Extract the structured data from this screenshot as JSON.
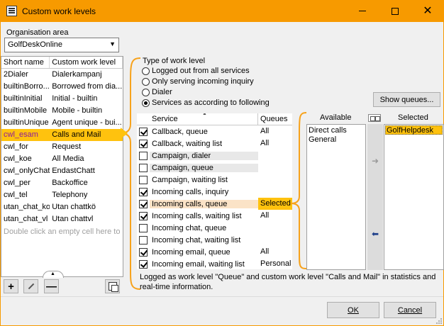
{
  "window": {
    "title": "Custom work levels",
    "controls": {
      "minimize": "—",
      "maximize": "☐",
      "close": "✕"
    }
  },
  "org": {
    "label": "Organisation area",
    "value": "GolfDeskOnline"
  },
  "levels": {
    "headers": [
      "Short name",
      "Custom work level"
    ],
    "rows": [
      [
        "2Dialer",
        "Dialerkampanj"
      ],
      [
        "builtinBorro...",
        "Borrowed from dia..."
      ],
      [
        "builtinInitial",
        "Initial - builtin"
      ],
      [
        "builtinMobile",
        "Mobile - builtin"
      ],
      [
        "builtinUnique",
        "Agent unique - bui..."
      ],
      [
        "cwl_esam",
        "Calls and Mail"
      ],
      [
        "cwl_for",
        "Request"
      ],
      [
        "cwl_koe",
        "All Media"
      ],
      [
        "cwl_onlyChat",
        "EndastChatt"
      ],
      [
        "cwl_per",
        "Backoffice"
      ],
      [
        "cwl_tel",
        "Telephony"
      ],
      [
        "utan_chat_ko",
        "Utan chattkö"
      ],
      [
        "utan_chat_vl",
        "Utan chattvl"
      ]
    ],
    "selected_index": 5,
    "hint": "Double click an empty cell here to ad"
  },
  "type_of_work_level": {
    "label": "Type of work level",
    "options": [
      "Logged out from all services",
      "Only serving incoming inquiry",
      "Dialer",
      "Services as according to following"
    ],
    "selected_index": 3
  },
  "show_queues_label": "Show queues...",
  "services": {
    "headers": [
      "Service",
      "Queues"
    ],
    "rows": [
      {
        "checked": true,
        "name": "Callback, queue",
        "queues": "All"
      },
      {
        "checked": true,
        "name": "Callback, waiting list",
        "queues": "All"
      },
      {
        "checked": false,
        "name": "Campaign, dialer",
        "queues": ""
      },
      {
        "checked": false,
        "name": "Campaign, queue",
        "queues": ""
      },
      {
        "checked": false,
        "name": "Campaign, waiting list",
        "queues": ""
      },
      {
        "checked": true,
        "name": "Incoming calls, inquiry",
        "queues": ""
      },
      {
        "checked": true,
        "name": "Incoming calls, queue",
        "queues": "Selected"
      },
      {
        "checked": true,
        "name": "Incoming calls, waiting list",
        "queues": "All"
      },
      {
        "checked": false,
        "name": "Incoming chat, queue",
        "queues": ""
      },
      {
        "checked": false,
        "name": "Incoming chat, waiting list",
        "queues": ""
      },
      {
        "checked": true,
        "name": "Incoming email, queue",
        "queues": "All"
      },
      {
        "checked": true,
        "name": "Incoming email, waiting list",
        "queues": "Personal"
      }
    ],
    "active_index": 6
  },
  "available": {
    "label": "Available",
    "items": [
      "Direct calls",
      "General"
    ]
  },
  "selected": {
    "label": "Selected",
    "items": [
      "GolfHelpdesk"
    ]
  },
  "info_text": "Logged as work level \"Queue\" and custom work level \"Calls and Mail\" in statistics and real-time information.",
  "buttons": {
    "ok": "OK",
    "cancel": "Cancel",
    "add": "+",
    "remove": "—"
  }
}
